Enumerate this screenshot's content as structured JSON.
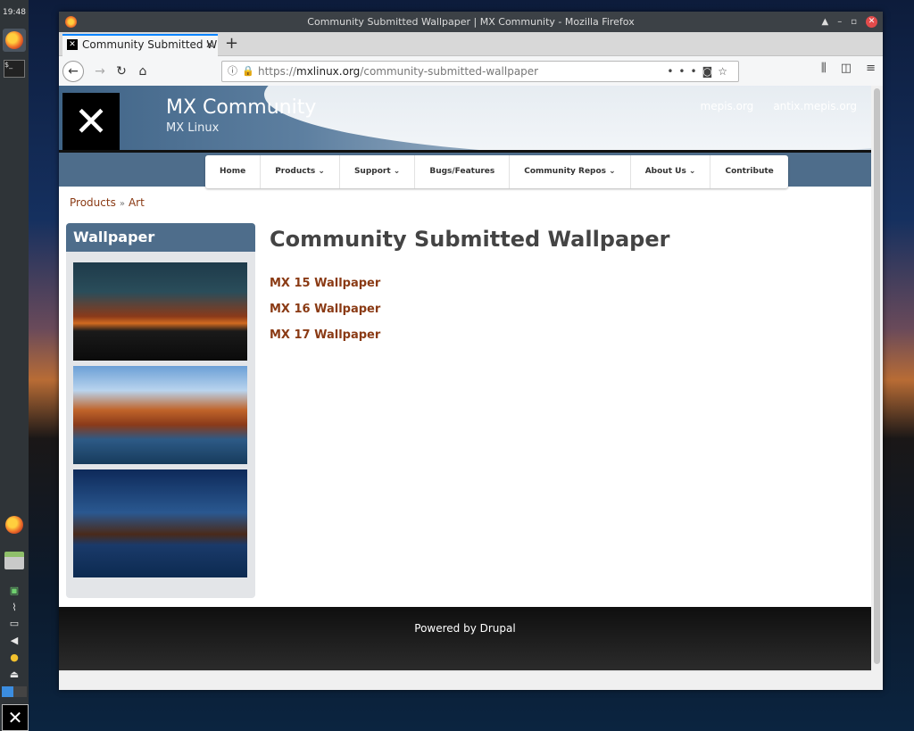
{
  "desktop": {
    "clock": "19:48"
  },
  "window": {
    "title": "Community Submitted Wallpaper | MX Community - Mozilla Firefox"
  },
  "browser": {
    "tab_title": "Community Submitted W",
    "url_host": "mxlinux.org",
    "url_prefix": "https://",
    "url_path": "/community-submitted-wallpaper"
  },
  "site": {
    "name": "MX Community",
    "slogan": "MX Linux",
    "header_links": [
      "mepis.org",
      "antix.mepis.org"
    ],
    "menu": [
      {
        "label": "Home"
      },
      {
        "label": "Products ⌄"
      },
      {
        "label": "Support ⌄"
      },
      {
        "label": "Bugs/Features"
      },
      {
        "label": "Community Repos ⌄"
      },
      {
        "label": "About Us ⌄"
      },
      {
        "label": "Contribute"
      }
    ],
    "breadcrumb": [
      "Products",
      "Art"
    ],
    "breadcrumb_sep": "»",
    "sidebar_title": "Wallpaper",
    "page_title": "Community Submitted Wallpaper",
    "links": [
      "MX 15 Wallpaper",
      "MX 16 Wallpaper",
      "MX 17 Wallpaper"
    ],
    "footer": "Powered by Drupal"
  }
}
